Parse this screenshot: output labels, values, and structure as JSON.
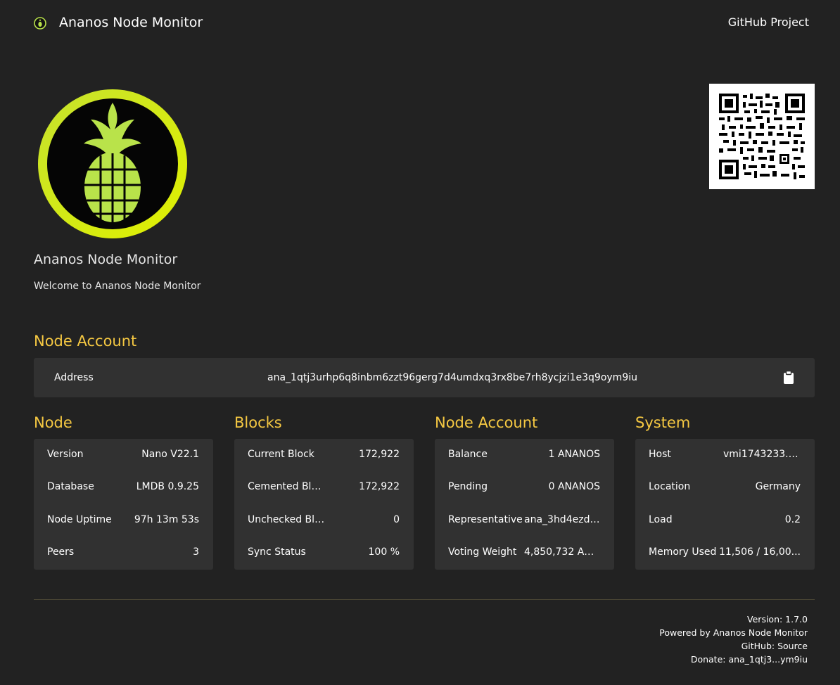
{
  "header": {
    "title": "Ananos Node Monitor",
    "github_link": "GitHub Project"
  },
  "hero": {
    "title": "Ananos Node Monitor",
    "subtitle": "Welcome to Ananos Node Monitor"
  },
  "node_account_section": {
    "heading": "Node Account",
    "address_label": "Address",
    "address_value": "ana_1qtj3urhp6q8inbm6zzt96gerg7d4umdxq3rx8be7rh8ycjzi1e3q9oym9iu"
  },
  "cards": {
    "node": {
      "heading": "Node",
      "rows": [
        {
          "key": "Version",
          "value": "Nano V22.1"
        },
        {
          "key": "Database",
          "value": "LMDB 0.9.25"
        },
        {
          "key": "Node Uptime",
          "value": "97h 13m 53s"
        },
        {
          "key": "Peers",
          "value": "3"
        }
      ]
    },
    "blocks": {
      "heading": "Blocks",
      "rows": [
        {
          "key": "Current Block",
          "value": "172,922"
        },
        {
          "key": "Cemented Blo...",
          "value": "172,922"
        },
        {
          "key": "Unchecked Blo...",
          "value": "0"
        },
        {
          "key": "Sync Status",
          "value": "100 %"
        }
      ]
    },
    "account": {
      "heading": "Node Account",
      "rows": [
        {
          "key": "Balance",
          "value": "1 ANANOS"
        },
        {
          "key": "Pending",
          "value": "0 ANANOS"
        },
        {
          "key": "Representative",
          "value": "ana_3hd4ezdg..."
        },
        {
          "key": "Voting Weight",
          "value": "4,850,732 AN..."
        }
      ]
    },
    "system": {
      "heading": "System",
      "rows": [
        {
          "key": "Host",
          "value": "vmi1743233.c..."
        },
        {
          "key": "Location",
          "value": "Germany"
        },
        {
          "key": "Load",
          "value": "0.2"
        },
        {
          "key": "Memory Used",
          "value": "11,506 / 16,00..."
        }
      ]
    }
  },
  "footer": {
    "version": "Version: 1.7.0",
    "powered_by": "Powered by Ananos Node Monitor",
    "github": "GitHub: Source",
    "donate": "Donate: ana_1qtj3...ym9iu"
  },
  "colors": {
    "background": "#222222",
    "card": "#313131",
    "accent": "#f5c842",
    "logo_green": "#b9e34a"
  }
}
